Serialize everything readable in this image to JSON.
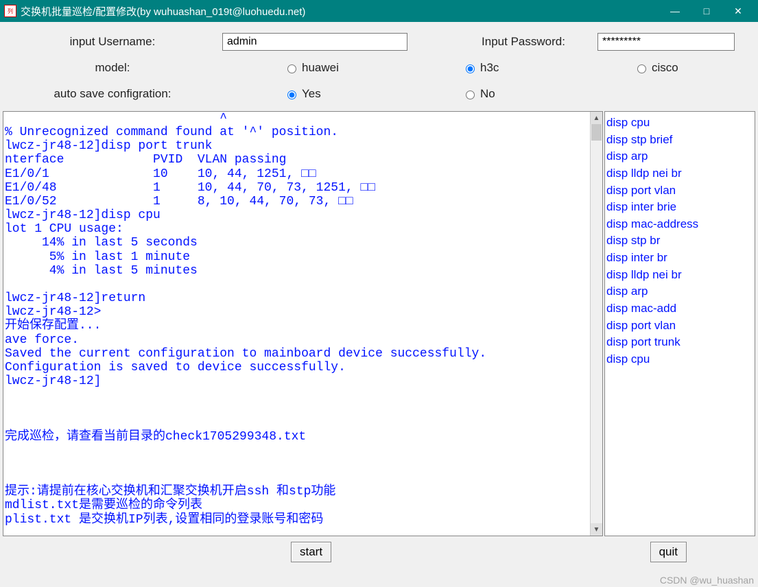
{
  "window": {
    "title": "交换机批量巡检/配置修改(by wuhuashan_019t@luohuedu.net)",
    "min": "—",
    "max": "□",
    "close": "✕"
  },
  "form": {
    "username_label": "input Username:",
    "username_value": "admin",
    "password_label": "Input Password:",
    "password_value": "*********",
    "model_label": "model:",
    "model_options": {
      "huawei": "huawei",
      "h3c": "h3c",
      "cisco": "cisco"
    },
    "model_selected": "h3c",
    "save_label": "auto save configration:",
    "save_options": {
      "yes": "Yes",
      "no": "No"
    },
    "save_selected": "yes"
  },
  "terminal_text": "                             ^\n% Unrecognized command found at '^' position.\nlwcz-jr48-12]disp port trunk\nnterface            PVID  VLAN passing\nE1/0/1              10    10, 44, 1251, □□\nE1/0/48             1     10, 44, 70, 73, 1251, □□\nE1/0/52             1     8, 10, 44, 70, 73, □□\nlwcz-jr48-12]disp cpu\nlot 1 CPU usage:\n     14% in last 5 seconds\n      5% in last 1 minute\n      4% in last 5 minutes\n\nlwcz-jr48-12]return\nlwcz-jr48-12>\n开始保存配置...\nave force.\nSaved the current configuration to mainboard device successfully.\nConfiguration is saved to device successfully.\nlwcz-jr48-12]\n\n\n\n完成巡检，请查看当前目录的check1705299348.txt\n\n\n\n提示:请提前在核心交换机和汇聚交换机开启ssh 和stp功能\nmdlist.txt是需要巡检的命令列表\nplist.txt 是交换机IP列表,设置相同的登录账号和密码",
  "cmdlist": [
    "disp cpu",
    "disp stp brief",
    "disp arp",
    "disp lldp nei br",
    "disp port vlan",
    "disp inter  brie",
    "disp mac-address",
    "disp  stp br",
    "disp  inter  br",
    "disp lldp nei br",
    "disp arp",
    "disp mac-add",
    "disp  port vlan",
    "disp port trunk",
    "disp cpu"
  ],
  "buttons": {
    "start": "start",
    "quit": "quit"
  },
  "watermark": "CSDN @wu_huashan"
}
